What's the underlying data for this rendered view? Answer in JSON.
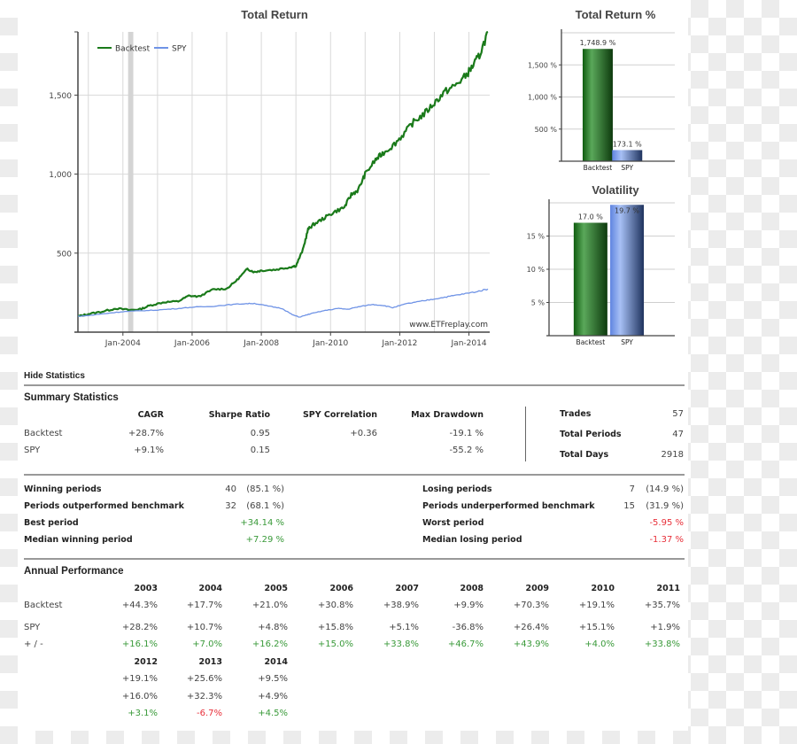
{
  "chart_data": [
    {
      "type": "line",
      "title": "Total Return",
      "xlabel": "",
      "ylabel": "",
      "x_range": [
        2002.7,
        2014.6
      ],
      "ylim": [
        0,
        1900
      ],
      "yticks": [
        500,
        1000,
        1500
      ],
      "ytick_labels": [
        "500",
        "1,000",
        "1,500"
      ],
      "xticks": [
        2004,
        2006,
        2008,
        2010,
        2012,
        2014
      ],
      "xtick_labels": [
        "Jan-2004",
        "Jan-2006",
        "Jan-2008",
        "Jan-2010",
        "Jan-2012",
        "Jan-2014"
      ],
      "grid": true,
      "legend": "top-left",
      "watermark": "www.ETFreplay.com",
      "shaded_band": [
        2004.15,
        2004.3
      ],
      "series": [
        {
          "name": "Backtest",
          "color": "#1a7a1a",
          "x": [
            2002.7,
            2003.0,
            2003.4,
            2003.8,
            2004.2,
            2004.5,
            2004.8,
            2005.2,
            2005.6,
            2005.9,
            2006.2,
            2006.6,
            2007.0,
            2007.3,
            2007.6,
            2007.8,
            2008.0,
            2008.4,
            2008.8,
            2009.0,
            2009.2,
            2009.35,
            2009.5,
            2009.8,
            2010.1,
            2010.4,
            2010.6,
            2010.8,
            2011.0,
            2011.3,
            2011.5,
            2011.8,
            2012.1,
            2012.4,
            2012.7,
            2013.0,
            2013.3,
            2013.6,
            2013.9,
            2014.1,
            2014.3,
            2014.55
          ],
          "values": [
            100,
            115,
            130,
            150,
            140,
            145,
            170,
            190,
            195,
            230,
            225,
            270,
            275,
            330,
            400,
            380,
            390,
            395,
            410,
            420,
            520,
            650,
            680,
            720,
            760,
            790,
            870,
            900,
            1000,
            1090,
            1130,
            1180,
            1250,
            1330,
            1380,
            1450,
            1520,
            1560,
            1620,
            1680,
            1750,
            1900
          ]
        },
        {
          "name": "SPY",
          "color": "#6f93e6",
          "x": [
            2002.7,
            2003.0,
            2003.5,
            2004.0,
            2004.5,
            2005.0,
            2005.5,
            2006.0,
            2006.5,
            2007.0,
            2007.5,
            2007.8,
            2008.2,
            2008.6,
            2008.9,
            2009.1,
            2009.4,
            2009.8,
            2010.2,
            2010.5,
            2010.8,
            2011.2,
            2011.5,
            2011.8,
            2012.2,
            2012.6,
            2013.0,
            2013.4,
            2013.8,
            2014.2,
            2014.55
          ],
          "values": [
            100,
            105,
            118,
            130,
            135,
            140,
            148,
            158,
            162,
            172,
            180,
            182,
            165,
            150,
            110,
            95,
            115,
            135,
            150,
            145,
            160,
            175,
            170,
            155,
            180,
            195,
            210,
            225,
            240,
            255,
            273
          ]
        }
      ]
    },
    {
      "type": "bar",
      "title": "Total Return %",
      "categories": [
        "Backtest",
        "SPY"
      ],
      "values": [
        1748.9,
        173.1
      ],
      "data_labels": [
        "1,748.9 %",
        "173.1 %"
      ],
      "ylim": [
        0,
        2000
      ],
      "yticks": [
        500,
        1000,
        1500
      ],
      "ytick_labels": [
        "500 %",
        "1,000 %",
        "1,500 %"
      ],
      "colors": [
        "#1f7a1f",
        "#6f93e6"
      ],
      "grid": true
    },
    {
      "type": "bar",
      "title": "Volatility",
      "categories": [
        "Backtest",
        "SPY"
      ],
      "values": [
        17.0,
        19.7
      ],
      "data_labels": [
        "17.0 %",
        "19.7 %"
      ],
      "ylim": [
        0,
        20
      ],
      "yticks": [
        5,
        10,
        15
      ],
      "ytick_labels": [
        "5 %",
        "10 %",
        "15 %"
      ],
      "colors": [
        "#1f7a1f",
        "#6f93e6"
      ],
      "grid": true
    }
  ],
  "stats": {
    "hide_label": "Hide Statistics",
    "summary": {
      "title": "Summary Statistics",
      "columns": [
        "CAGR",
        "Sharpe Ratio",
        "SPY Correlation",
        "Max Drawdown"
      ],
      "rows": [
        {
          "name": "Backtest",
          "cagr": "+28.7%",
          "sharpe": "0.95",
          "corr": "+0.36",
          "dd": "-19.1 %"
        },
        {
          "name": "SPY",
          "cagr": "+9.1%",
          "sharpe": "0.15",
          "corr": "",
          "dd": "-55.2 %"
        }
      ],
      "side": [
        {
          "label": "Trades",
          "value": "57"
        },
        {
          "label": "Total Periods",
          "value": "47"
        },
        {
          "label": "Total Days",
          "value": "2918"
        }
      ]
    },
    "periods_left": [
      {
        "label": "Winning periods",
        "count": "40",
        "pct": "(85.1 %)",
        "value": ""
      },
      {
        "label": "Periods outperformed benchmark",
        "count": "32",
        "pct": "(68.1 %)",
        "value": ""
      },
      {
        "label": "Best period",
        "count": "",
        "pct": "",
        "value": "+34.14 %"
      },
      {
        "label": "Median winning period",
        "count": "",
        "pct": "",
        "value": "+7.29 %"
      }
    ],
    "periods_right": [
      {
        "label": "Losing periods",
        "count": "7",
        "pct": "(14.9 %)",
        "value": ""
      },
      {
        "label": "Periods underperformed benchmark",
        "count": "15",
        "pct": "(31.9 %)",
        "value": ""
      },
      {
        "label": "Worst period",
        "count": "",
        "pct": "",
        "value": "-5.95 %"
      },
      {
        "label": "Median losing period",
        "count": "",
        "pct": "",
        "value": "-1.37 %"
      }
    ],
    "annual": {
      "title": "Annual Performance",
      "row_labels": [
        "Backtest",
        "SPY",
        "+ / -"
      ],
      "blocks": [
        {
          "years": [
            "2003",
            "2004",
            "2005",
            "2006",
            "2007",
            "2008",
            "2009",
            "2010",
            "2011"
          ],
          "backtest": [
            "+44.3%",
            "+17.7%",
            "+21.0%",
            "+30.8%",
            "+38.9%",
            "+9.9%",
            "+70.3%",
            "+19.1%",
            "+35.7%"
          ],
          "spy": [
            "+28.2%",
            "+10.7%",
            "+4.8%",
            "+15.8%",
            "+5.1%",
            "-36.8%",
            "+26.4%",
            "+15.1%",
            "+1.9%"
          ],
          "diff": [
            "+16.1%",
            "+7.0%",
            "+16.2%",
            "+15.0%",
            "+33.8%",
            "+46.7%",
            "+43.9%",
            "+4.0%",
            "+33.8%"
          ]
        },
        {
          "years": [
            "2012",
            "2013",
            "2014"
          ],
          "backtest": [
            "+19.1%",
            "+25.6%",
            "+9.5%"
          ],
          "spy": [
            "+16.0%",
            "+32.3%",
            "+4.9%"
          ],
          "diff": [
            "+3.1%",
            "-6.7%",
            "+4.5%"
          ]
        }
      ]
    }
  }
}
